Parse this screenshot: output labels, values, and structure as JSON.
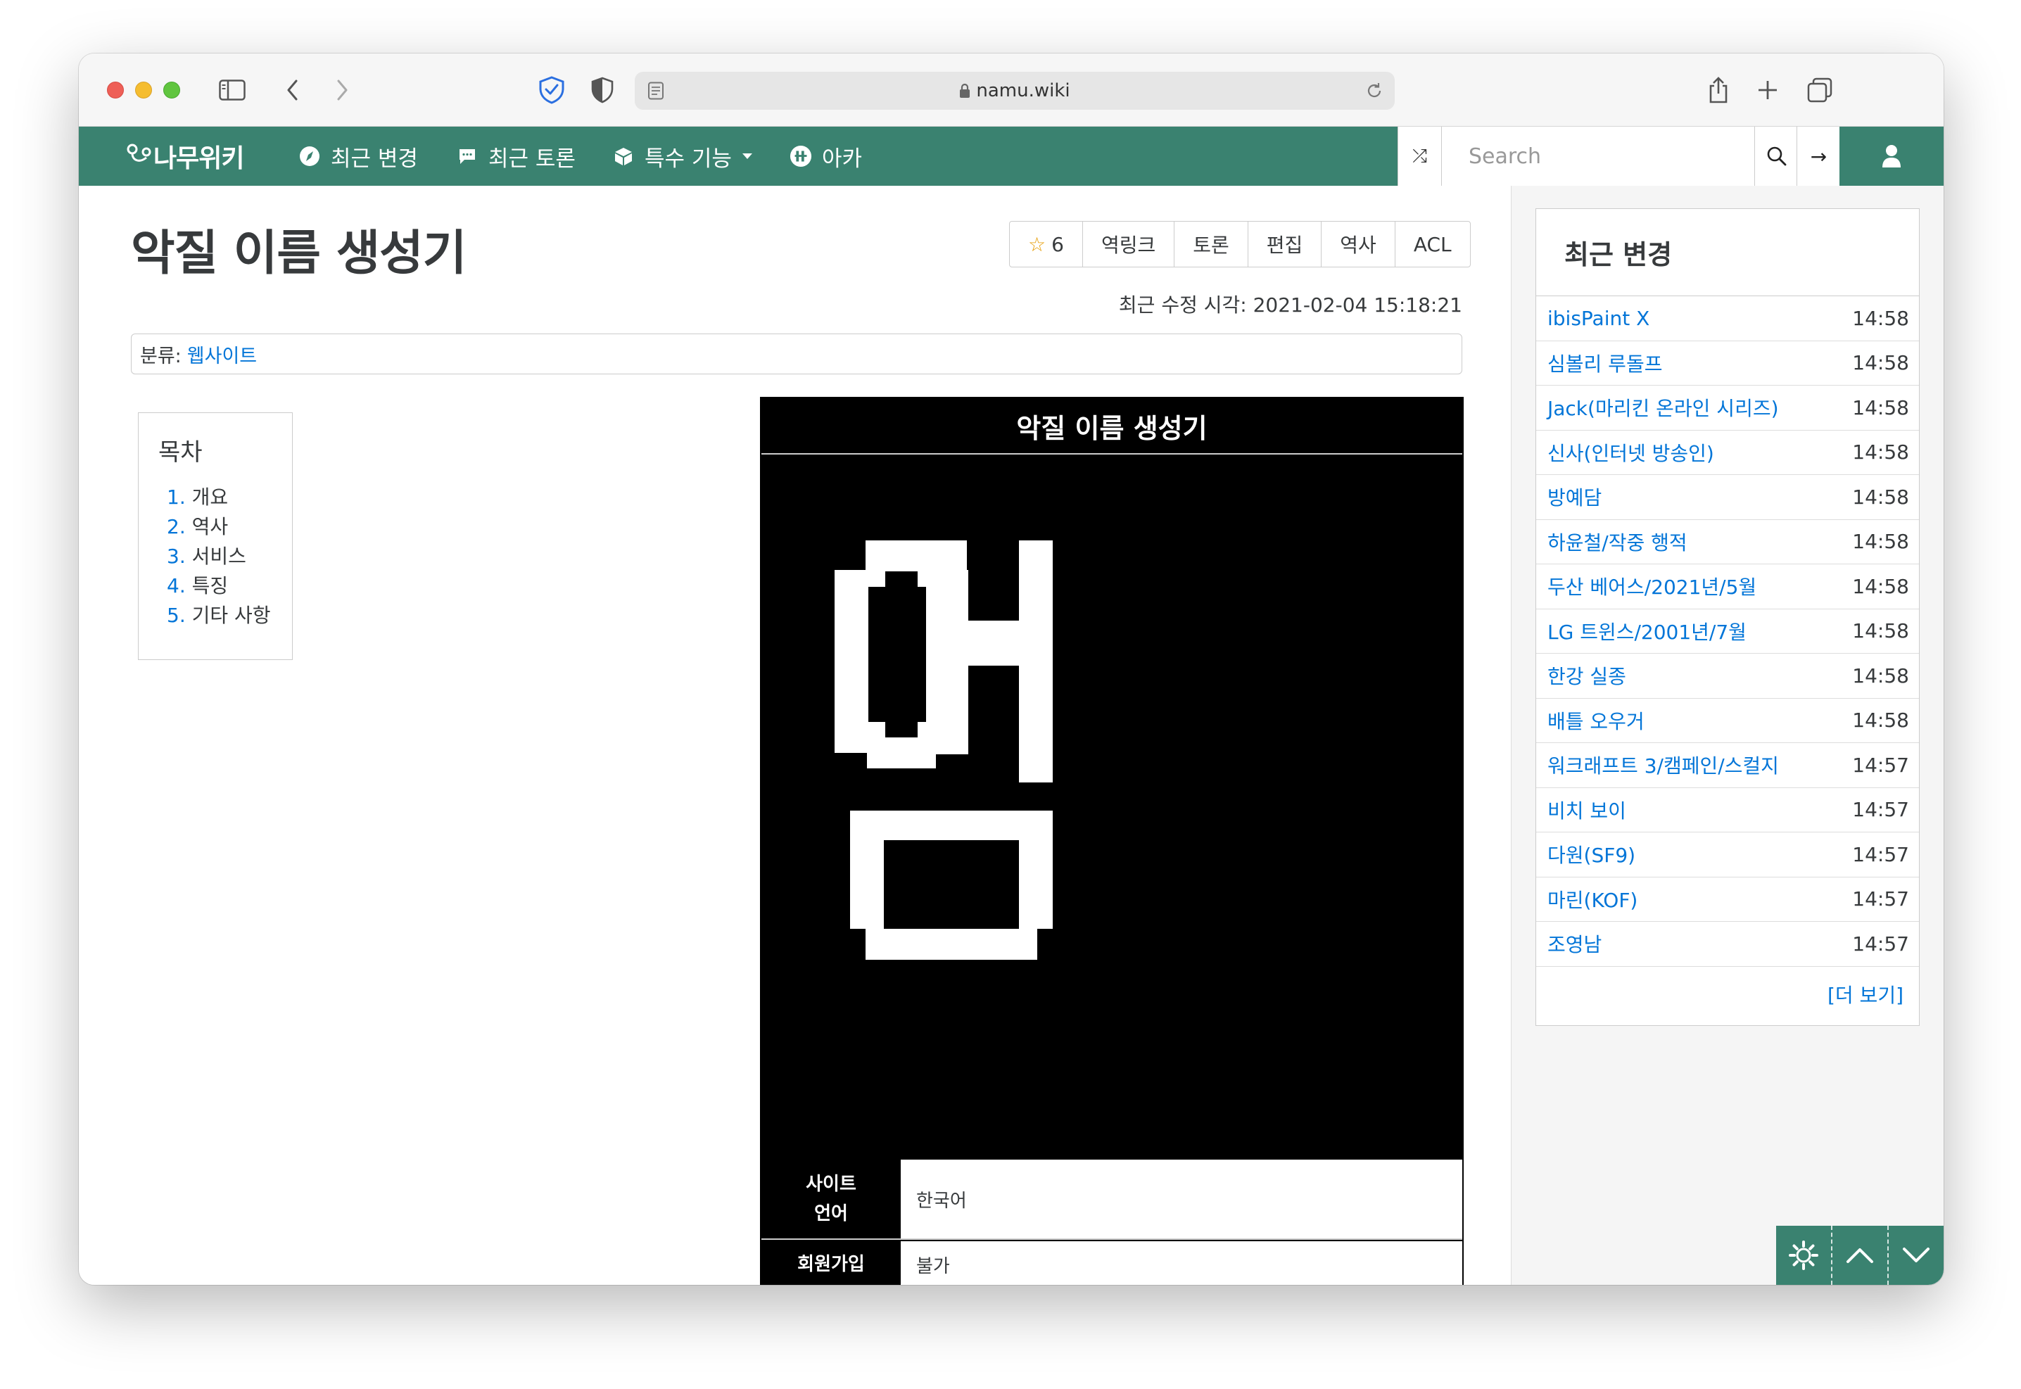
{
  "browser": {
    "url_host": "namu.wiki"
  },
  "nav": {
    "logo": "나무위키",
    "items": [
      {
        "label": "최근 변경",
        "icon": "compass-icon"
      },
      {
        "label": "최근 토론",
        "icon": "comment-icon"
      },
      {
        "label": "특수 기능",
        "icon": "cube-icon"
      },
      {
        "label": "아카",
        "icon": "arca-icon"
      }
    ],
    "search_placeholder": "Search",
    "random_symbol": "⤮",
    "go_symbol": "→"
  },
  "article": {
    "title": "악질 이름 생성기",
    "star_symbol": "☆",
    "star_count": "6",
    "actions": [
      "역링크",
      "토론",
      "편집",
      "역사",
      "ACL"
    ],
    "last_modified": "최근 수정 시각: 2021-02-04 15:18:21",
    "category_label": "분류:",
    "category_link": "웹사이트"
  },
  "toc": {
    "title": "목차",
    "items": [
      {
        "num": "1.",
        "label": "개요"
      },
      {
        "num": "2.",
        "label": "역사"
      },
      {
        "num": "3.",
        "label": "서비스"
      },
      {
        "num": "4.",
        "label": "특징"
      },
      {
        "num": "5.",
        "label": "기타 사항"
      }
    ]
  },
  "infobox": {
    "title": "악질 이름 생성기",
    "rows": [
      {
        "key": "사이트\n언어",
        "value": "한국어"
      },
      {
        "key": "회원가입",
        "value": "불가"
      }
    ]
  },
  "recent": {
    "title": "최근 변경",
    "items": [
      {
        "title": "ibisPaint X",
        "time": "14:58"
      },
      {
        "title": "심볼리 루돌프",
        "time": "14:58"
      },
      {
        "title": "Jack(마리킨 온라인 시리즈)",
        "time": "14:58"
      },
      {
        "title": "신사(인터넷 방송인)",
        "time": "14:58"
      },
      {
        "title": "방예담",
        "time": "14:58"
      },
      {
        "title": "하윤철/작중 행적",
        "time": "14:58"
      },
      {
        "title": "두산 베어스/2021년/5월",
        "time": "14:58"
      },
      {
        "title": "LG 트윈스/2001년/7월",
        "time": "14:58"
      },
      {
        "title": "한강 실종",
        "time": "14:58"
      },
      {
        "title": "배틀 오우거",
        "time": "14:58"
      },
      {
        "title": "워크래프트 3/캠페인/스컬지",
        "time": "14:57"
      },
      {
        "title": "비치 보이",
        "time": "14:57"
      },
      {
        "title": "다원(SF9)",
        "time": "14:57"
      },
      {
        "title": "마린(KOF)",
        "time": "14:57"
      },
      {
        "title": "조영남",
        "time": "14:57"
      }
    ],
    "more": "[더 보기]"
  },
  "colors": {
    "brand": "#3a8270",
    "link": "#0275d8",
    "text": "#373a3c"
  }
}
